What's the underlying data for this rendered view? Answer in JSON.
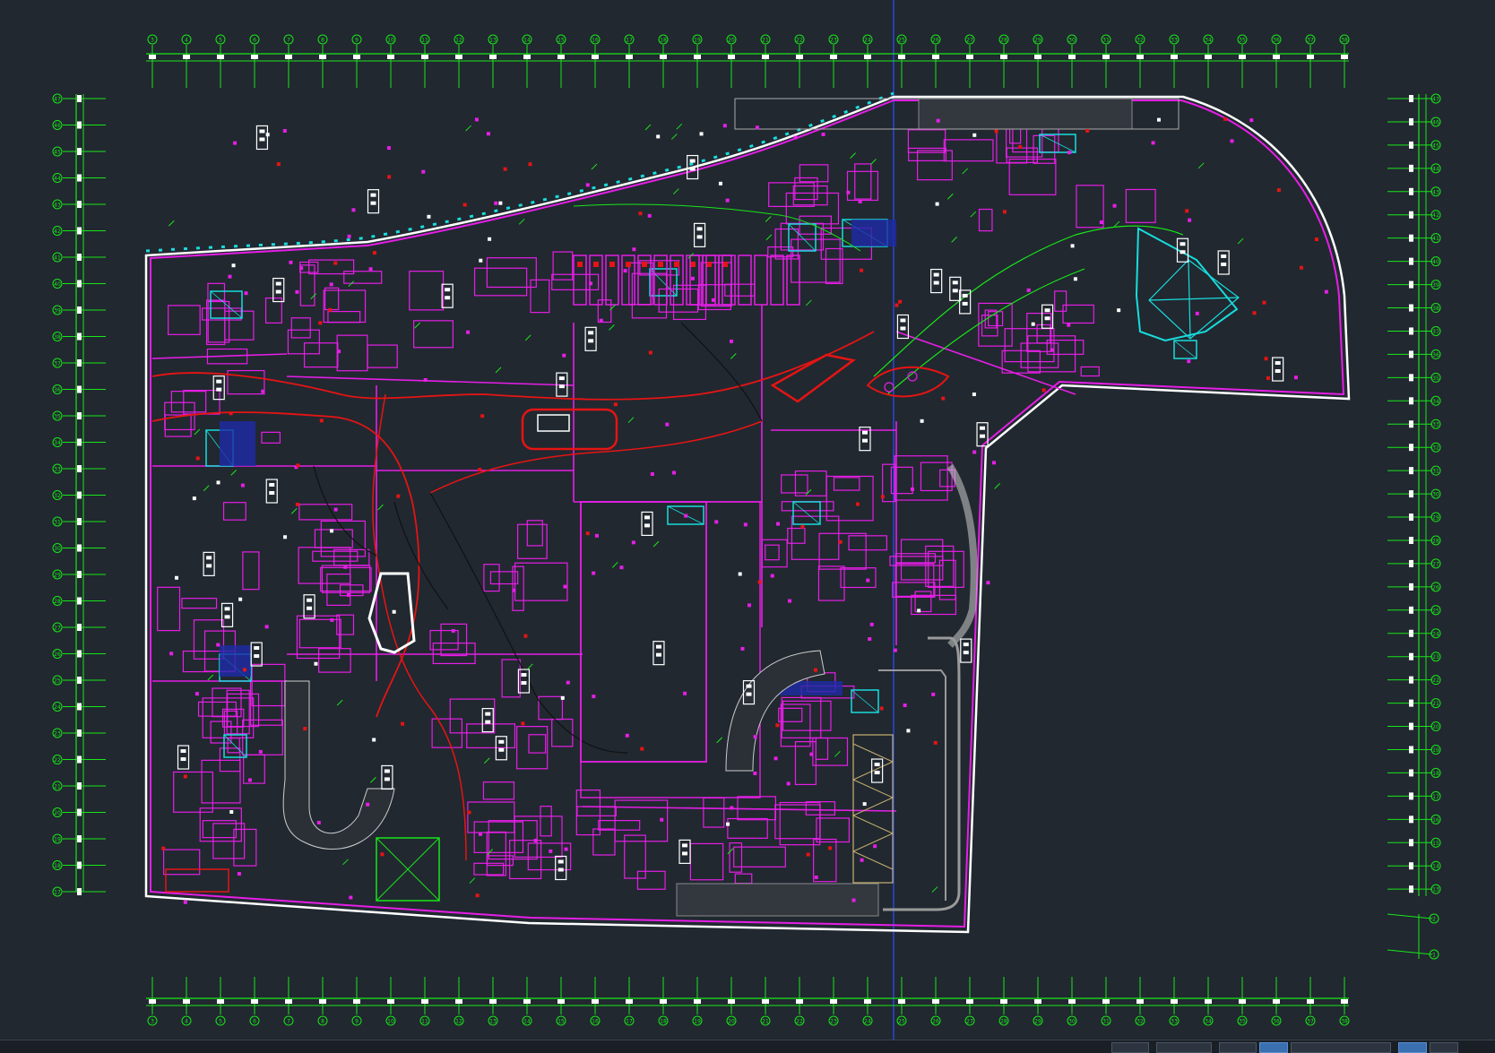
{
  "drawing": {
    "background": "#212830",
    "colors": {
      "grid": "#19e619",
      "walls": "#e61ee6",
      "route": "#e61414",
      "cyan": "#19dcdc",
      "outline": "#ffffff",
      "text": "#ffffff",
      "crosshair": "#2850ff"
    },
    "top_axis_labels": [
      "3",
      "4",
      "5",
      "6",
      "7",
      "8",
      "9",
      "10",
      "11",
      "12",
      "13",
      "14",
      "15",
      "16",
      "17",
      "18",
      "19",
      "20",
      "21",
      "22",
      "23",
      "24",
      "25",
      "26",
      "27",
      "28",
      "29",
      "30",
      "31",
      "32",
      "33",
      "34",
      "35",
      "36",
      "37",
      "38"
    ],
    "bottom_axis_labels": [
      "3",
      "4",
      "5",
      "6",
      "7",
      "8",
      "9",
      "10",
      "11",
      "12",
      "13",
      "14",
      "15",
      "16",
      "17",
      "18",
      "19",
      "20",
      "21",
      "22",
      "23",
      "24",
      "25",
      "26",
      "27",
      "28",
      "29",
      "30",
      "31",
      "32",
      "33",
      "34",
      "35",
      "36",
      "37",
      "38"
    ],
    "left_axis_labels": [
      "47",
      "46",
      "45",
      "44",
      "43",
      "42",
      "41",
      "40",
      "39",
      "38",
      "37",
      "36",
      "35",
      "34",
      "33",
      "32",
      "31",
      "30",
      "29",
      "28",
      "27",
      "26",
      "25",
      "24",
      "23",
      "22",
      "21",
      "20",
      "19",
      "18",
      "17"
    ],
    "right_axis_labels": [
      "47",
      "46",
      "45",
      "44",
      "43",
      "42",
      "41",
      "40",
      "39",
      "38",
      "37",
      "36",
      "35",
      "34",
      "33",
      "32",
      "31",
      "30",
      "29",
      "28",
      "27",
      "26",
      "25",
      "24",
      "23",
      "22",
      "21",
      "20",
      "19",
      "18",
      "17",
      "16",
      "15",
      "14",
      "13",
      "12",
      "11",
      "10"
    ]
  },
  "statusbar": {
    "items": [
      "",
      ""
    ]
  }
}
